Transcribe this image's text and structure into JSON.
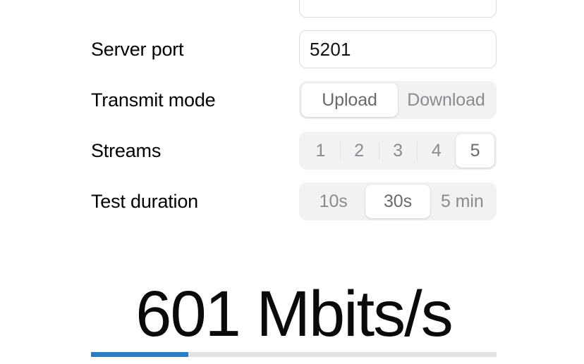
{
  "form": {
    "rows": [
      {
        "label": "",
        "type": "input",
        "value": "",
        "placeholder": ""
      },
      {
        "label": "Server port",
        "type": "input",
        "value": "5201",
        "placeholder": "5201"
      },
      {
        "label": "Transmit mode",
        "type": "segmented",
        "options": [
          "Upload",
          "Download"
        ],
        "selected": "Upload"
      },
      {
        "label": "Streams",
        "type": "segmented",
        "options": [
          "1",
          "2",
          "3",
          "4",
          "5"
        ],
        "selected": "5"
      },
      {
        "label": "Test duration",
        "type": "segmented",
        "options": [
          "10s",
          "30s",
          "5 min"
        ],
        "selected": "30s"
      }
    ]
  },
  "result": {
    "value": "601 Mbits/s",
    "throughput": 601,
    "unit": "Mbits/s",
    "progress_percent": 24,
    "progress_color": "#2b7cc0",
    "track_color": "#e3e3e5"
  },
  "colors": {
    "background": "#ffffff",
    "label_text": "#000000",
    "segment_text": "#8b8b90",
    "segment_selected_text": "#69696e",
    "segment_track": "#f2f2f4",
    "segment_selected_fill": "#ffffff",
    "input_border": "#dcdcdf",
    "accent": "#2b7cc0"
  }
}
